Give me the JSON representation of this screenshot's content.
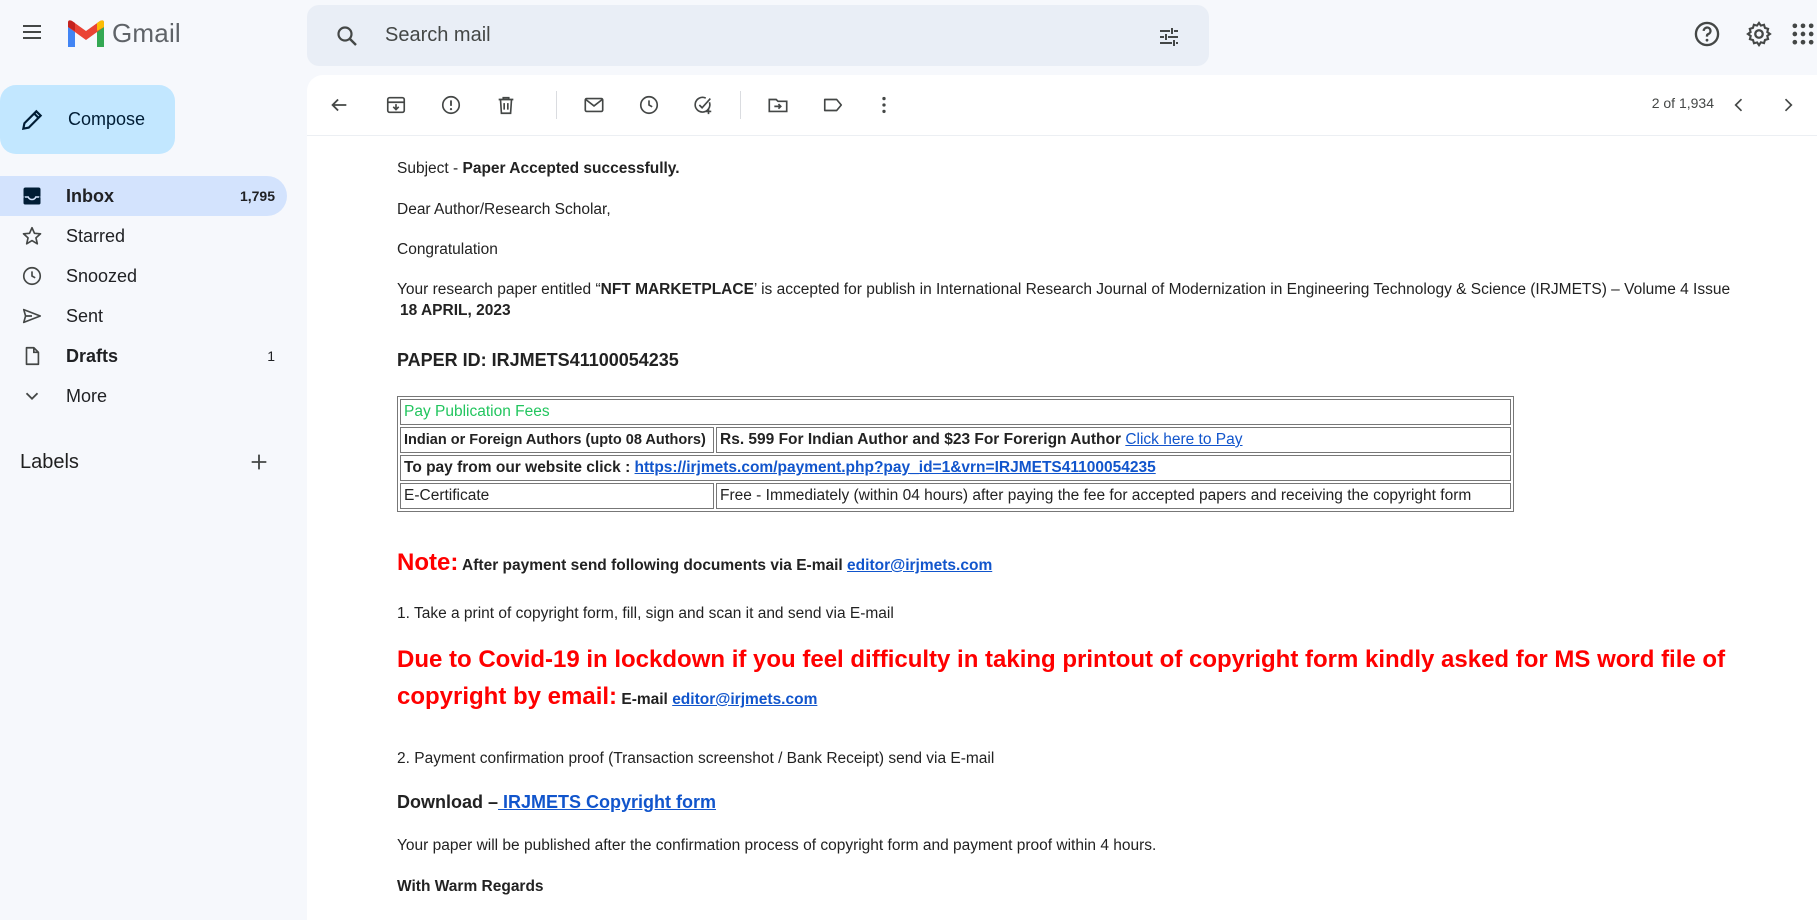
{
  "header": {
    "app_name": "Gmail",
    "search_placeholder": "Search mail"
  },
  "sidebar": {
    "compose_label": "Compose",
    "items": [
      {
        "label": "Inbox",
        "count": "1,795",
        "icon": "inbox-icon",
        "active": true
      },
      {
        "label": "Starred",
        "count": "",
        "icon": "star-icon"
      },
      {
        "label": "Snoozed",
        "count": "",
        "icon": "clock-icon"
      },
      {
        "label": "Sent",
        "count": "",
        "icon": "send-icon"
      },
      {
        "label": "Drafts",
        "count": "1",
        "icon": "draft-icon"
      },
      {
        "label": "More",
        "count": "",
        "icon": "chevron-down-icon"
      }
    ],
    "labels_title": "Labels"
  },
  "toolbar": {
    "pager_text": "2 of 1,934"
  },
  "email": {
    "subject_prefix": "Subject - ",
    "subject": "Paper Accepted successfully.",
    "greeting": "Dear Author/Research Scholar,",
    "congrats": "Congratulation",
    "para1_a": "Your research paper entitled “",
    "paper_title": "NFT MARKETPLACE",
    "para1_b": "’ is accepted for publish in International Research Journal of Modernization in Engineering Technology & Science (IRJMETS) – Volume 4 Issue",
    "issue_date": "18 APRIL, 2023",
    "paper_id": "PAPER ID: IRJMETS41100054235",
    "table": {
      "header": "Pay Publication Fees",
      "row1_label": "Indian or Foreign Authors (upto 08 Authors)",
      "row1_value": "Rs. 599 For Indian Author and $23 For Forerign Author",
      "row1_link": "Click here to Pay",
      "row2_label": "To pay from our website click : ",
      "row2_link": "https://irjmets.com/payment.php?pay_id=1&vrn=IRJMETS41100054235",
      "row3_label": "E-Certificate",
      "row3_value": "Free - Immediately (within 04 hours) after paying the fee for accepted papers and receiving the copyright form"
    },
    "note_label": "Note:",
    "note_text": " After payment send following documents via E-mail ",
    "email_link": "editor@irjmets.com",
    "step1": "1. Take a print of copyright form, fill, sign and scan it and send via E-mail",
    "covid_line1": "Due to Covid-19 in lockdown if you feel difficulty in taking printout of copyright form kindly asked for MS word file of",
    "covid_line2": "copyright by email:",
    "covid_email_label": " E-mail ",
    "step2": "2. Payment confirmation proof (Transaction screenshot / Bank Receipt) send via E-mail",
    "download_label": "Download –",
    "download_link": " IRJMETS Copyright form",
    "publish_note": "Your paper will be published after the confirmation process of copyright form and payment proof within 4 hours.",
    "regards": "With Warm Regards"
  }
}
